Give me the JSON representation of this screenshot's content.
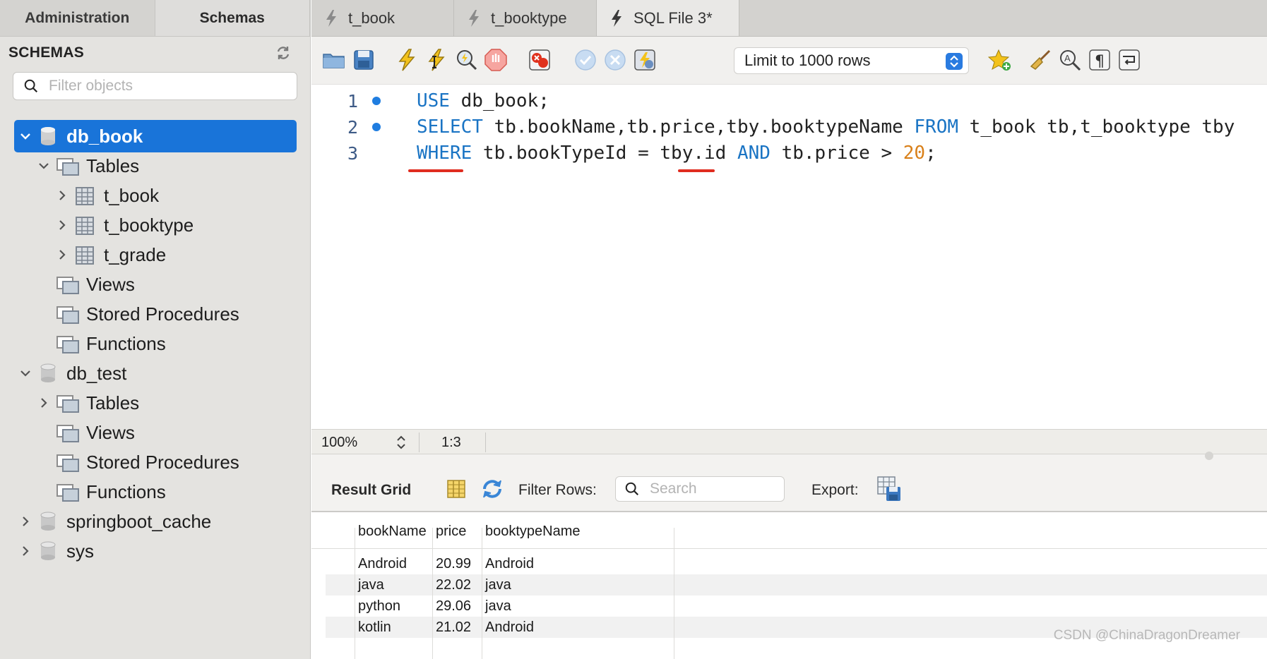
{
  "sidebar": {
    "tabs": [
      "Administration",
      "Schemas"
    ],
    "active_tab": "Schemas",
    "section_title": "SCHEMAS",
    "filter_placeholder": "Filter objects",
    "tree": {
      "db_book": {
        "name": "db_book",
        "tables_label": "Tables",
        "tables": [
          "t_book",
          "t_booktype",
          "t_grade"
        ],
        "views_label": "Views",
        "procs_label": "Stored Procedures",
        "functions_label": "Functions"
      },
      "db_test": {
        "name": "db_test",
        "tables_label": "Tables",
        "views_label": "Views",
        "procs_label": "Stored Procedures",
        "functions_label": "Functions"
      },
      "springboot_cache": "springboot_cache",
      "sys": "sys"
    }
  },
  "tabs": [
    {
      "label": "t_book"
    },
    {
      "label": "t_booktype"
    },
    {
      "label": "SQL File 3*"
    }
  ],
  "toolbar": {
    "limit_label": "Limit to 1000 rows"
  },
  "editor": {
    "lines": [
      {
        "num": "1",
        "kw1": "USE",
        "rest1": " db_book;"
      },
      {
        "num": "2",
        "kw1": "SELECT",
        "rest1": " tb.bookName,tb.price,tby.booktypeName ",
        "kw2": "FROM",
        "rest2": " t_book tb,t_booktype tby"
      },
      {
        "num": "3",
        "kw1": "WHERE",
        "rest1": " tb.bookTypeId = tby.id ",
        "kw2": "AND",
        "rest2": " tb.price > ",
        "number": "20",
        "tail": ";"
      }
    ]
  },
  "status": {
    "zoom": "100%",
    "cursor": "1:3"
  },
  "results": {
    "title": "Result Grid",
    "filter_label": "Filter Rows:",
    "search_placeholder": "Search",
    "export_label": "Export:",
    "columns": [
      "bookName",
      "price",
      "booktypeName"
    ],
    "rows": [
      [
        "Android",
        "20.99",
        "Android"
      ],
      [
        "java",
        "22.02",
        "java"
      ],
      [
        "python",
        "29.06",
        "java"
      ],
      [
        "kotlin",
        "21.02",
        "Android"
      ]
    ]
  },
  "watermark": "CSDN @ChinaDragonDreamer",
  "colors": {
    "keyword": "#1a74c4",
    "number": "#d9801a",
    "selection": "#1974d9",
    "annotation": "#e02c1f"
  }
}
